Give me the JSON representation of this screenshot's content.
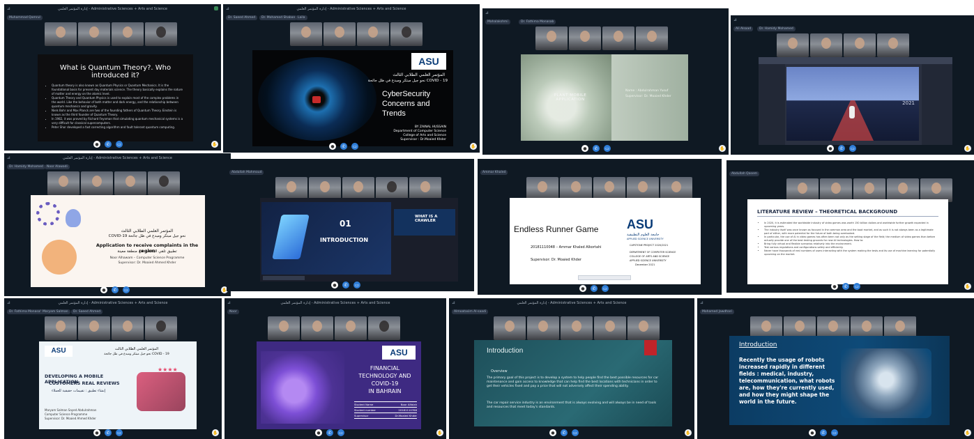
{
  "meeting_title": "إدارة المؤتمر العلمي - Administrative Sciences + Arts and Science",
  "tiles": [
    {
      "pinned": "Muhammad Qamrul",
      "chips": [
        "Muhammad Qamrul"
      ],
      "slide": {
        "title": "What is Quantum Theory?. Who introduced it?",
        "bullets": [
          "Quantum theory is also known as Quantum Physics or Quantum Mechanics. It is the foundational basis for present day materials science. The theory basically explains the nature of matter and energy on the atomic level.",
          "Quantum Theory and Quantum Physics is used to explain most of the complex problems in the world. Like the behavior of both matter and dark energy, and the relationship between quantum mechanics and gravity.",
          "Niels Bohr and Max Planck are two of the founding fathers of Quantum Theory. Einstein is known as the third founder of Quantum Theory.",
          "In 1982, it was proved by Richard Feynman that simulating quantum mechanical systems is a very difficult for classical supercomputers.",
          "Peter Shor developed a fast correcting algorithm and fault tolerant quantum computing."
        ]
      }
    },
    {
      "chips": [
        "Dr. Saeed Ahmed",
        "Dr. Mohamed Shaban",
        "Laila"
      ],
      "slide": {
        "conf_ar": "المؤتمر العلمي الطلابي الثالث",
        "conf_ar2": "نحو جيل مبتكر ومبدع في ظل جائحة COVID - 19",
        "title": "CyberSecurity Concerns and Trends",
        "author": "BY ZAINAL HUSSAIN",
        "dept": "Department of Computer Science",
        "college": "College of Arts and Science",
        "supervisor": "Supervisor : Dr.Moaied Khder"
      }
    },
    {
      "chips": [
        "Mahalakshmi",
        "Dr. Fathima Monasab"
      ],
      "slide": {
        "heading": "PLANT MOBILE APPLICATION",
        "name": "Name : Abdulrahman Yusuf",
        "supervisor": "Supervisor: Dr. Moaied Khder"
      }
    },
    {
      "chips": [
        "Ali Alsaad",
        "Dr. Hamidy Mohamed"
      ],
      "slide": {
        "label": "2021"
      }
    },
    {
      "chips": [
        "Dr. Hamidy Mohamed",
        "Noor Alawadi"
      ],
      "slide": {
        "conf_ar": "المؤتمر العلمي الطلابي الثالث",
        "covid": "COVID-19 نحو جيل مبتكر ومبدع في ظل جائحة",
        "ar_line": "تطبيق تلقي البلاغات في منطقة معينة",
        "title": "Application to receive complaints in the region",
        "author": "Noor Alhawam – Computer Science Programme",
        "supervisor": "Supervisor: Dr. Moaied Ahmed Khder"
      }
    },
    {
      "chips": [
        "Abdallah Mahmoud"
      ],
      "slide": {
        "num": "01",
        "title": "INTRODUCTION",
        "side": "WHAT IS A CRAWLER"
      }
    },
    {
      "chips": [
        "Ammar Khaled"
      ],
      "slide": {
        "title": "Endless Runner Game",
        "student": "20181110048 – Ammar Khaled Alkortahi",
        "supervisor": "Supervisor: Dr. Moaied Khder",
        "asu": "ASU",
        "asu_ar": "جامعة العلوم التطبيقية",
        "asu_en": "APPLIED SCIENCE UNIVERSITY",
        "capstone": "CAPSTONE PROJECT 2020/2021",
        "dept": "DEPARTMENT OF COMPUTER SCIENCE",
        "college": "COLLEGE OF ARTS AND SCIENCE",
        "uni": "APPLIED SCIENCE UNIVERSITY",
        "date": "December 2021"
      }
    },
    {
      "chips": [
        "Abdullah Qasem"
      ],
      "slide": {
        "title": "LITERATURE REVIEW – THEORETICAL BACKGROUND",
        "bullets": [
          "In 2020, it is estimated the worldwide industry of video games was worth 150 billion dollars and worldwide further growth expected in upcoming years.",
          "The industry itself was once known as focused in the common area and the boot market, and as such it is not always been as a legitimate part of either, with more potential for the future of both being overlooked.",
          "In particular, the use of AI in video games has often been not only as the setting stage of the field; the medium of video games than before actually provide one of the best testing grounds for new AI technologies. How to:",
          "Bring fully virtual and flexible scenarios relatively into the environment.",
          "Test various regulations and configurations safely and efficiently.",
          "Never have thousands of real numbers of users interacting with the system making the tests and its use of machine learning for potentially upcoming on the market."
        ]
      }
    },
    {
      "chips": [
        "Dr. Fathima Monasab",
        "Maryam Salman",
        "Dr. Saeed Ahmed"
      ],
      "slide": {
        "conf_ar": "المؤتمر العلمي الطلابي الثالث",
        "covid": "نحو جيل مبتكر ومبدع في ظل جائحة COVID - 19",
        "title1": "DEVELOPING A MOBILE APPLICATION",
        "title2": "CUSTOMERS REAL REVIEWS",
        "ar_title": "إنشاء تطبيق : تقييمات حقيقية للعملاء",
        "author": "Maryam Salman Sayed Abdulrahman",
        "program": "Computer Science Programme",
        "supervisor": "Supervisor: Dr. Moaied Ahmed Khder"
      }
    },
    {
      "chips": [
        "Noor"
      ],
      "slide": {
        "title1": "FINANCIAL",
        "title2": "TECHNOLOGY AND",
        "title3": "COVID-19",
        "title4": "IN BAHRAIN",
        "table": [
          [
            "Student Name",
            "Noor Alfalah"
          ],
          [
            "Student number",
            "20181110788"
          ],
          [
            "Supervisor",
            "Dr.Moaied Khder"
          ]
        ]
      }
    },
    {
      "chips": [
        "Almoatasim Al-saadi"
      ],
      "slide": {
        "title": "Introduction",
        "overview": "Overview",
        "p1": "The primary goal of this project is to develop a system to help people find the best possible resources for car maintenance and gain access to knowledge that can help find the best locations with technicians in order to get their vehicles fixed and pay a price that will not adversely affect their spending ability.",
        "p2": "The car repair service industry is an environment that is always evolving and will always be in need of tools and resources that meet today's standards."
      }
    },
    {
      "chips": [
        "Mohamed Jawdhari"
      ],
      "slide": {
        "title": "Introduction",
        "body": "Recently the usage of robots increased rapidly in different fields : medical, industry, telecommunication, what robots are, how they're currently used, and how they might shape the world in the future."
      }
    }
  ]
}
